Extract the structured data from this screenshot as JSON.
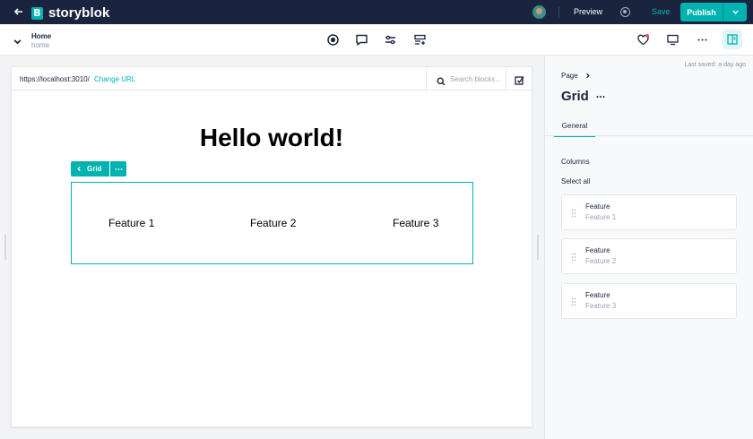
{
  "topbar": {
    "brand": "storyblok",
    "brand_mark": "B",
    "preview_label": "Preview",
    "save_label": "Save",
    "publish_label": "Publish",
    "accent_color": "#00b3b0",
    "background_color": "#1b243f"
  },
  "toolbar": {
    "title": "Home",
    "slug": "home",
    "icons": [
      "record-icon",
      "comment-icon",
      "sliders-icon",
      "block-insert-icon",
      "heart-icon",
      "monitor-icon",
      "more-icon",
      "panel-layout-icon"
    ]
  },
  "preview": {
    "url": "https://localhost:3010/",
    "change_url_label": "Change URL",
    "search_placeholder": "Search blocks...",
    "heading": "Hello world!",
    "grid_tag_label": "Grid",
    "features": [
      "Feature 1",
      "Feature 2",
      "Feature 3"
    ]
  },
  "sidebar": {
    "last_saved": "Last saved: a day ago",
    "breadcrumb": "Page",
    "block_title": "Grid",
    "tabs": [
      {
        "label": "General",
        "active": true
      }
    ],
    "columns_label": "Columns",
    "select_all_label": "Select all",
    "columns": [
      {
        "type": "Feature",
        "name": "Feature 1"
      },
      {
        "type": "Feature",
        "name": "Feature 2"
      },
      {
        "type": "Feature",
        "name": "Feature 3"
      }
    ]
  }
}
